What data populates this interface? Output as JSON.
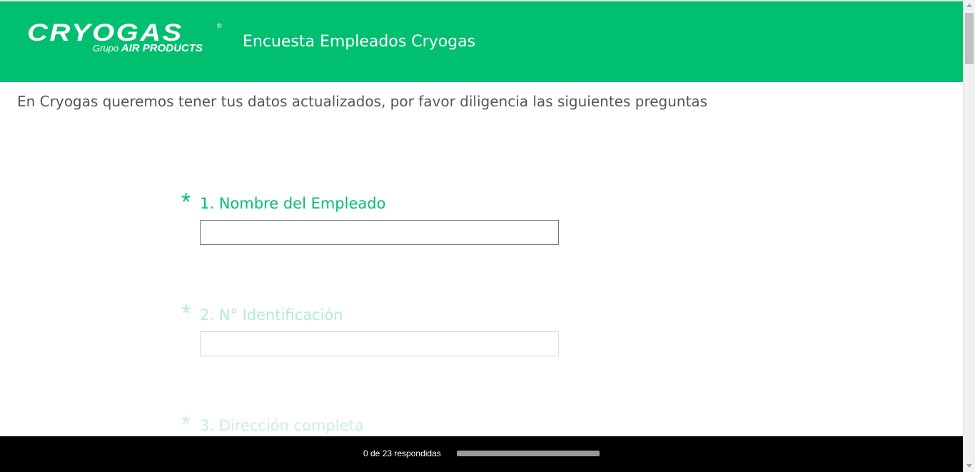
{
  "header": {
    "logo": {
      "main": "CRYOGAS",
      "registered": "®",
      "sub_plain": "Grupo ",
      "sub_bold": "AIR PRODUCTS"
    },
    "title": "Encuesta Empleados Cryogas",
    "background_color": "#00bf6f"
  },
  "intro": "En Cryogas queremos tener tus datos actualizados, por favor diligencia las siguientes preguntas",
  "questions": [
    {
      "asterisk": "*",
      "label": "1. Nombre del Empleado",
      "value": "",
      "state": "active"
    },
    {
      "asterisk": "*",
      "label": "2. N° Identificación",
      "value": "",
      "state": "faded"
    },
    {
      "asterisk": "*",
      "label": "3. Dirección completa",
      "state": "faded"
    }
  ],
  "footer": {
    "progress_text": "0 de 23 respondidas",
    "answered": 0,
    "total": 23,
    "progress_fraction": 0
  },
  "colors": {
    "accent": "#00bf6f",
    "footer_bg": "#000000",
    "text": "#555555"
  }
}
